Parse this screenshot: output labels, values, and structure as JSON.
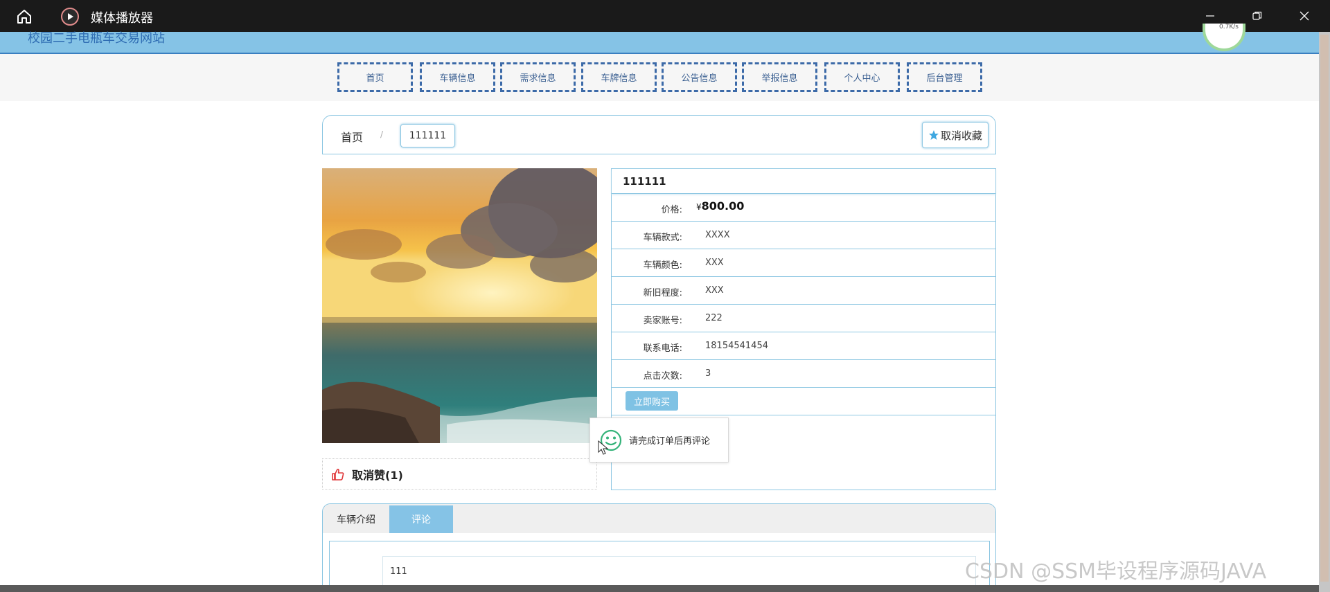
{
  "window": {
    "title": "媒体播放器"
  },
  "site": {
    "title": "校园二手电瓶车交易网站",
    "speed": "0.7K/s"
  },
  "nav": {
    "items": [
      "首页",
      "车辆信息",
      "需求信息",
      "车牌信息",
      "公告信息",
      "举报信息",
      "个人中心",
      "后台管理"
    ]
  },
  "breadcrumb": {
    "home": "首页",
    "separator": "/",
    "current": "111111"
  },
  "favorite_button": "取消收藏",
  "like": {
    "label": "取消赞(1)"
  },
  "detail": {
    "title": "111111",
    "price_label": "价格:",
    "currency": "¥",
    "price": "800.00",
    "rows": [
      {
        "label": "车辆款式:",
        "value": "XXXX"
      },
      {
        "label": "车辆颜色:",
        "value": "XXX"
      },
      {
        "label": "新旧程度:",
        "value": "XXX"
      },
      {
        "label": "卖家账号:",
        "value": "222"
      },
      {
        "label": "联系电话:",
        "value": "18154541454"
      },
      {
        "label": "点击次数:",
        "value": "3"
      }
    ],
    "buy_button": "立即购买"
  },
  "toast": {
    "message": "请完成订单后再评论"
  },
  "tabs": {
    "items": [
      "车辆介绍",
      "评论"
    ],
    "active": "评论"
  },
  "comment": {
    "value": "111"
  },
  "watermark": "CSDN @SSM毕设程序源码JAVA",
  "colors": {
    "accent": "#85c3e6",
    "border": "#8cc6e2",
    "nav_border": "#3c6aa8"
  }
}
